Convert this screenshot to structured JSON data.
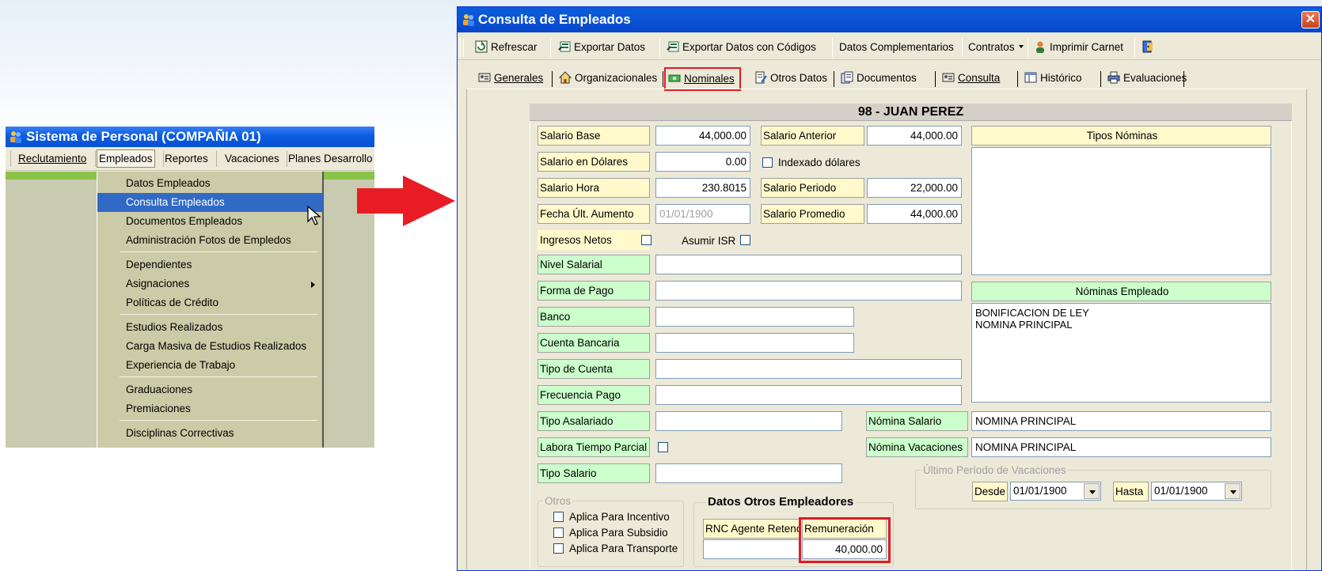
{
  "left_app": {
    "title": "Sistema de Personal (COMPAÑIA 01)",
    "menu": [
      "Reclutamiento",
      "Empleados",
      "Reportes",
      "Vacaciones",
      "Planes Desarrollo"
    ],
    "dropdown": [
      "Datos Empleados",
      "Consulta Empleados",
      "Documentos Empleados",
      "Administración Fotos de Empledos",
      "Dependientes",
      "Asignaciones",
      "Políticas de Crédito",
      "Estudios Realizados",
      "Carga Masiva de Estudios Realizados",
      "Experiencia de Trabajo",
      "Graduaciones",
      "Premiaciones",
      "Disciplinas Correctivas"
    ]
  },
  "window": {
    "title": "Consulta de Empleados",
    "close_label": "✕"
  },
  "toolbar": {
    "refresh": "Refrescar",
    "export": "Exportar Datos",
    "export_codes": "Exportar Datos con Códigos",
    "complementary": "Datos Complementarios",
    "contracts": "Contratos",
    "print_card": "Imprimir Carnet"
  },
  "tabs": {
    "generales": "Generales",
    "organizacionales": "Organizacionales",
    "nominales": "Nominales",
    "otros": "Otros Datos",
    "documentos": "Documentos",
    "consulta": "Consulta",
    "historico": "Histórico",
    "evaluaciones": "Evaluaciones"
  },
  "employee_header": "98 - JUAN PEREZ",
  "form": {
    "salario_base_label": "Salario Base",
    "salario_base": "44,000.00",
    "salario_anterior_label": "Salario Anterior",
    "salario_anterior": "44,000.00",
    "salario_dolares_label": "Salario en Dólares",
    "salario_dolares": "0.00",
    "indexado_label": "Indexado dólares",
    "salario_hora_label": "Salario Hora",
    "salario_hora": "230.8015",
    "salario_periodo_label": "Salario Periodo",
    "salario_periodo": "22,000.00",
    "fecha_aumento_label": "Fecha Últ. Aumento",
    "fecha_aumento": "01/01/1900",
    "salario_promedio_label": "Salario Promedio",
    "salario_promedio": "44,000.00",
    "ingresos_netos_label": "Ingresos Netos",
    "asumir_isr_label": "Asumir ISR",
    "nivel_salarial_label": "Nivel Salarial",
    "forma_pago_label": "Forma de Pago",
    "banco_label": "Banco",
    "cuenta_bancaria_label": "Cuenta Bancaria",
    "tipo_cuenta_label": "Tipo de Cuenta",
    "frecuencia_pago_label": "Frecuencia  Pago",
    "tipo_asalariado_label": "Tipo Asalariado",
    "labora_parcial_label": "Labora Tiempo Parcial",
    "tipo_salario_label": "Tipo Salario",
    "nomina_salario_label": "Nómina Salario",
    "nomina_salario": "NOMINA PRINCIPAL",
    "nomina_vacaciones_label": "Nómina Vacaciones",
    "nomina_vacaciones": "NOMINA PRINCIPAL",
    "tipos_nominas_label": "Tipos Nóminas",
    "nominas_empleado_label": "Nóminas Empleado",
    "nominas_empleado": [
      "BONIFICACION DE LEY",
      "NOMINA PRINCIPAL"
    ],
    "ultimo_periodo_label": "Último Período de Vacaciones",
    "desde_label": "Desde",
    "desde": "01/01/1900",
    "hasta_label": "Hasta",
    "hasta": "01/01/1900",
    "otros_label": "Otros",
    "aplica_incentivo": "Aplica Para Incentivo",
    "aplica_subsidio": "Aplica Para Subsidio",
    "aplica_transporte": "Aplica Para Transporte",
    "otros_empleadores_label": "Datos Otros Empleadores",
    "rnc_label": "RNC Agente Retenc.",
    "remuneracion_label": "Remuneración",
    "remuneracion": "40,000.00"
  }
}
